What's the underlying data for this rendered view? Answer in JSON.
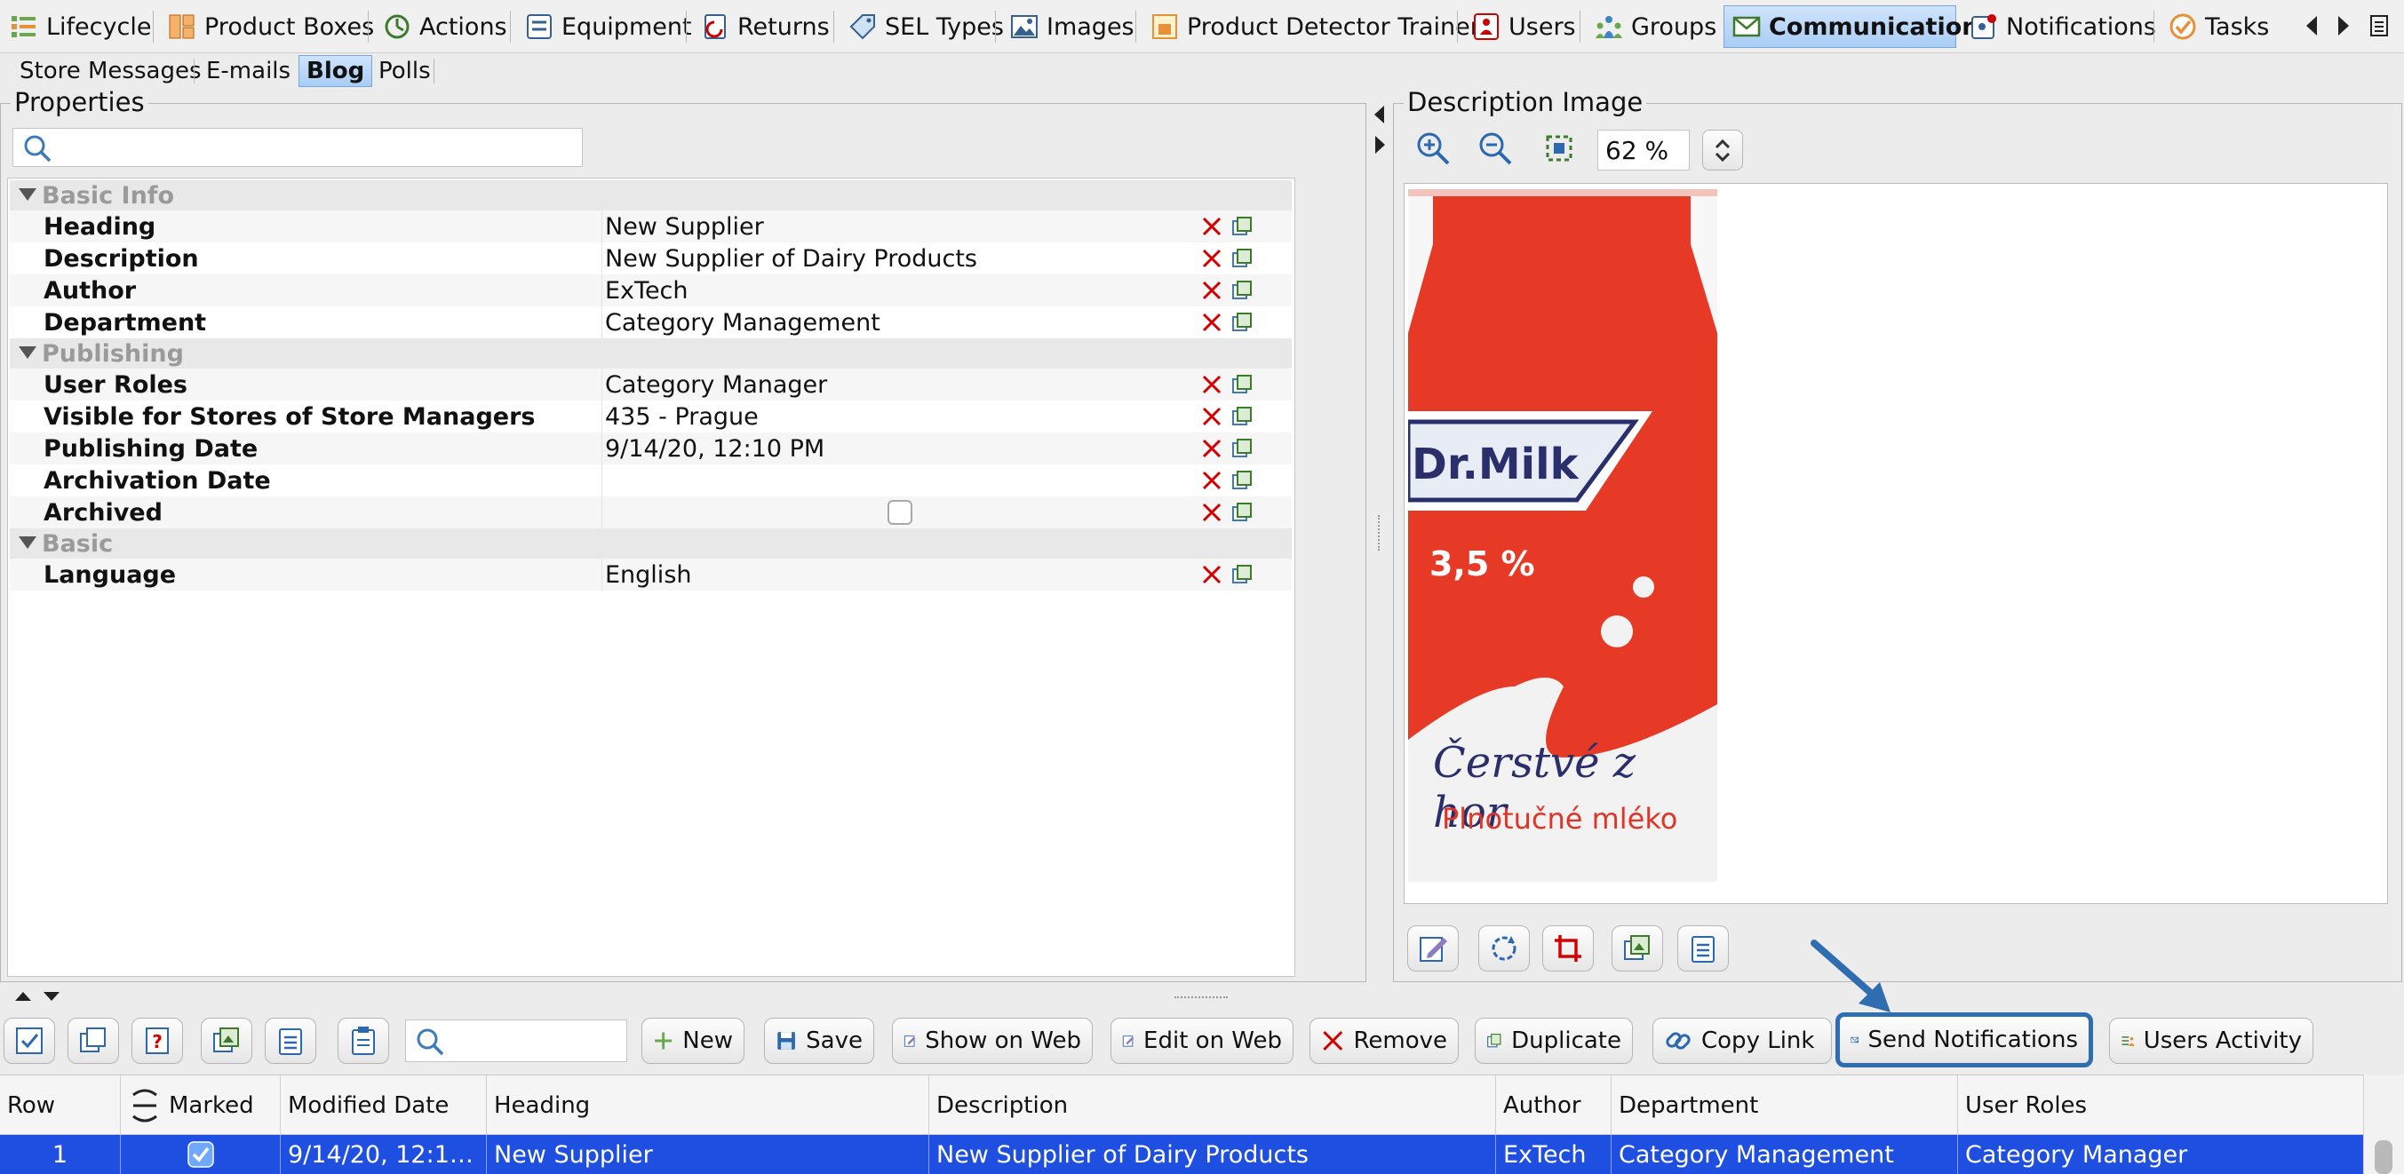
{
  "top_tabs": [
    {
      "label": "Lifecycle"
    },
    {
      "label": "Product Boxes"
    },
    {
      "label": "Actions"
    },
    {
      "label": "Equipment"
    },
    {
      "label": "Returns"
    },
    {
      "label": "SEL Types"
    },
    {
      "label": "Images"
    },
    {
      "label": "Product Detector Trainer"
    },
    {
      "label": "Users"
    },
    {
      "label": "Groups"
    },
    {
      "label": "Communication",
      "active": true
    },
    {
      "label": "Notifications"
    },
    {
      "label": "Tasks"
    }
  ],
  "sub_tabs": [
    {
      "label": "Store Messages"
    },
    {
      "label": "E-mails"
    },
    {
      "label": "Blog",
      "active": true
    },
    {
      "label": "Polls"
    }
  ],
  "properties": {
    "title": "Properties",
    "search_value": "",
    "groups": [
      {
        "name": "Basic Info",
        "rows": [
          {
            "label": "Heading",
            "value": "New Supplier"
          },
          {
            "label": "Description",
            "value": "New Supplier of Dairy Products"
          },
          {
            "label": "Author",
            "value": "ExTech"
          },
          {
            "label": "Department",
            "value": "Category Management"
          }
        ]
      },
      {
        "name": "Publishing",
        "rows": [
          {
            "label": "User Roles",
            "value": "Category Manager"
          },
          {
            "label": "Visible for Stores of Store Managers",
            "value": "435 - Prague"
          },
          {
            "label": "Publishing Date",
            "value": "9/14/20, 12:10 PM"
          },
          {
            "label": "Archivation Date",
            "value": ""
          },
          {
            "label": "Archived",
            "value": "",
            "checkbox": false
          }
        ]
      },
      {
        "name": "Basic",
        "rows": [
          {
            "label": "Language",
            "value": "English"
          }
        ]
      }
    ]
  },
  "description_image": {
    "title": "Description Image",
    "zoom": "62 %",
    "carton": {
      "brand": "Dr.Milk",
      "fat": "3,5 %",
      "slogan": "Čerstvé z hor",
      "product": "Plnotučné mléko"
    }
  },
  "toolbar": {
    "search_value": "",
    "buttons": {
      "new": "New",
      "save": "Save",
      "show_on_web": "Show on Web",
      "edit_on_web": "Edit on Web",
      "remove": "Remove",
      "duplicate": "Duplicate",
      "copy_link": "Copy Link",
      "send_notifications": "Send Notifications",
      "users_activity": "Users Activity"
    }
  },
  "table": {
    "columns": {
      "row": "Row",
      "marked": "Marked",
      "modified": "Modified Date",
      "heading": "Heading",
      "description": "Description",
      "author": "Author",
      "department": "Department",
      "roles": "User Roles"
    },
    "rows": [
      {
        "row": "1",
        "marked": true,
        "modified": "9/14/20, 12:1…",
        "heading": "New Supplier",
        "description": "New Supplier of Dairy Products",
        "author": "ExTech",
        "department": "Category Management",
        "roles": "Category Manager"
      }
    ]
  },
  "colors": {
    "selection": "#1f4fe0",
    "active_tab": "#a9cdf5",
    "highlight_border": "#2f6db1",
    "carton_red": "#e63a27"
  }
}
